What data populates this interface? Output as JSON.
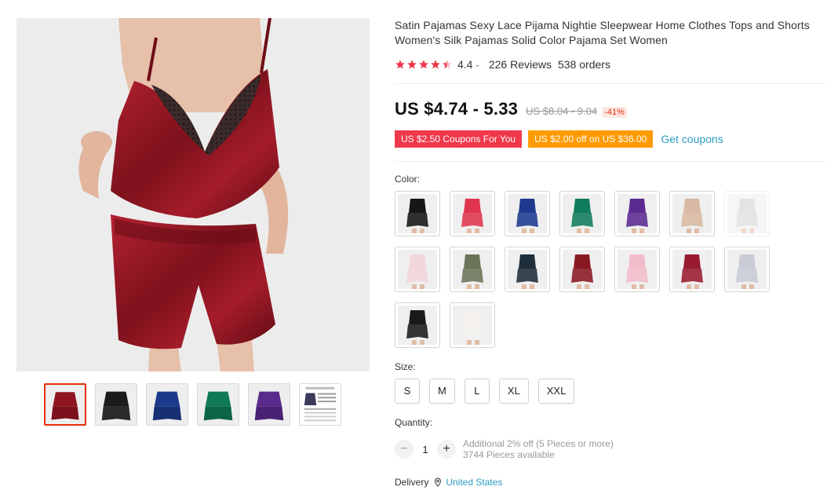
{
  "product": {
    "title": "Satin Pajamas Sexy Lace Pijama Nightie Sleepwear Home Clothes Tops and Shorts Women's Silk Pajamas Solid Color Pajama Set Women",
    "rating_value": "4.4",
    "stars_filled": 4.4,
    "reviews": "226 Reviews",
    "orders": "538 orders",
    "price": "US $4.74 - 5.33",
    "original_price": "US $8.04 - 9.04",
    "discount": "-41%",
    "coupon_1": "US $2.50 Coupons For You",
    "coupon_2": "US $2.00 off on US $36.00",
    "get_coupons": "Get coupons",
    "color_label": "Color:",
    "size_label": "Size:",
    "sizes": [
      "S",
      "M",
      "L",
      "XL",
      "XXL"
    ],
    "quantity_label": "Quantity:",
    "quantity": "1",
    "qty_minus": "−",
    "qty_plus": "+",
    "qty_discount_note": "Additional 2% off (5 Pieces or more)",
    "qty_available": "3744 Pieces available",
    "delivery_label": "Delivery",
    "delivery_country": "United States"
  },
  "gallery": {
    "main_color": "#8e1520",
    "thumbnail_colors": [
      "#8e1520",
      "#1b1b1b",
      "#1c3a8c",
      "#0f7a55",
      "#5a2a8c",
      "chart"
    ]
  },
  "swatch_colors": [
    "#161616",
    "#e0354f",
    "#1e3a8f",
    "#0f7c5b",
    "#5b2a91",
    "#d8b9a3",
    "#cfcfcf",
    "#f1d6dc",
    "#6b7358",
    "#1e2f3b",
    "#8a1822",
    "#f2bccb",
    "#9a1a30",
    "#c9ccd6",
    "#1a1a1a",
    "#f4f1ee"
  ],
  "colors": {
    "accent_red": "#e62e04",
    "star_red": "#f0384b",
    "coupon_red": "#f0384b",
    "coupon_orange": "#ff9a00",
    "link_blue": "#2e9cc3"
  }
}
